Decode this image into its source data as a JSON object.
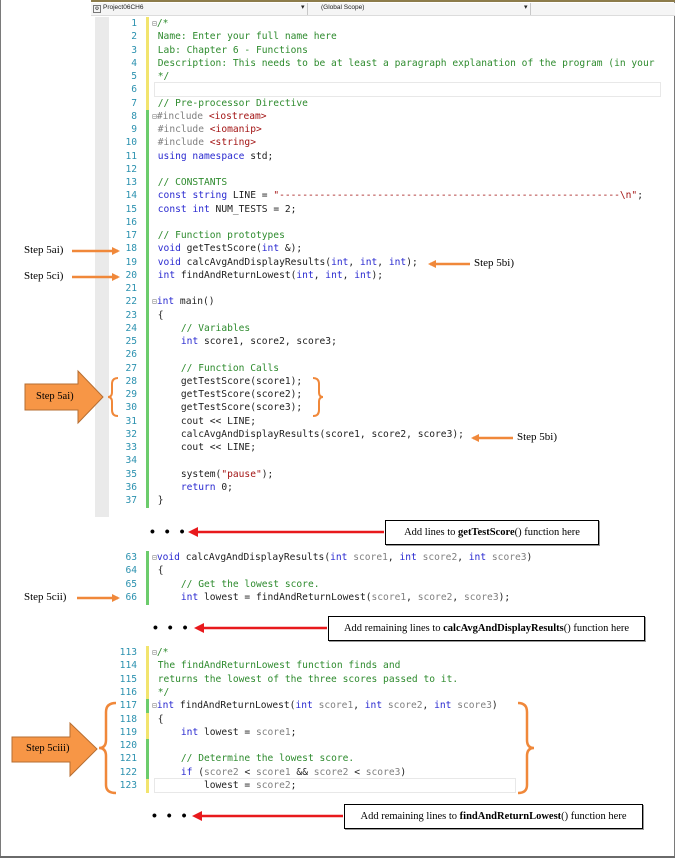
{
  "navbar": {
    "project": "Project06CH6",
    "scope": "(Global Scope)",
    "project_icon": "project-icon",
    "dropdown_icon": "▾"
  },
  "blocks": [
    {
      "lines": [
        {
          "n": "1",
          "html": "<span class='fold'>⊟</span><span class='cm'>/*</span>",
          "bar": "y"
        },
        {
          "n": "2",
          "html": " <span class='cm'>Name: Enter your full name here</span>",
          "bar": "y"
        },
        {
          "n": "3",
          "html": " <span class='cm'>Lab: Chapter 6 - Functions</span>",
          "bar": "y"
        },
        {
          "n": "4",
          "html": " <span class='cm'>Description: This needs to be at least a paragraph explanation of the program (in your</span>",
          "bar": "y"
        },
        {
          "n": "5",
          "html": " <span class='cm'>*/</span>",
          "bar": "y"
        },
        {
          "n": "6",
          "html": " ",
          "bar": "y",
          "caret": true
        },
        {
          "n": "7",
          "html": " <span class='cm'>// Pre-processor Directive</span>",
          "bar": "y"
        },
        {
          "n": "8",
          "html": "<span class='fold'>⊟</span><span class='pp'>#include</span> <span class='st'>&lt;iostream&gt;</span>",
          "bar": "g"
        },
        {
          "n": "9",
          "html": " <span class='pp'>#include</span> <span class='st'>&lt;iomanip&gt;</span>",
          "bar": "g"
        },
        {
          "n": "10",
          "html": " <span class='pp'>#include</span> <span class='st'>&lt;string&gt;</span>",
          "bar": "g"
        },
        {
          "n": "11",
          "html": " <span class='kw'>using namespace</span> std;",
          "bar": "g"
        },
        {
          "n": "12",
          "html": "",
          "bar": "g"
        },
        {
          "n": "13",
          "html": " <span class='cm'>// CONSTANTS</span>",
          "bar": "g"
        },
        {
          "n": "14",
          "html": " <span class='kw'>const</span> <span class='kw'>string</span> LINE = <span class='st'>\"-----------------------------------------------------------\\n\"</span>;",
          "bar": "g"
        },
        {
          "n": "15",
          "html": " <span class='kw'>const</span> <span class='kw'>int</span> NUM_TESTS = 2;",
          "bar": "g"
        },
        {
          "n": "16",
          "html": "",
          "bar": "g"
        },
        {
          "n": "17",
          "html": " <span class='cm'>// Function prototypes</span>",
          "bar": "g"
        },
        {
          "n": "18",
          "html": " <span class='kw'>void</span> getTestScore(<span class='kw'>int</span> &amp;);",
          "bar": "g"
        },
        {
          "n": "19",
          "html": " <span class='kw'>void</span> calcAvgAndDisplayResults(<span class='kw'>int</span>, <span class='kw'>int</span>, <span class='kw'>int</span>);",
          "bar": "g"
        },
        {
          "n": "20",
          "html": " <span class='kw'>int</span> findAndReturnLowest(<span class='kw'>int</span>, <span class='kw'>int</span>, <span class='kw'>int</span>);",
          "bar": "g"
        },
        {
          "n": "21",
          "html": "",
          "bar": "g"
        },
        {
          "n": "22",
          "html": "<span class='fold'>⊟</span><span class='kw'>int</span> main()",
          "bar": "g"
        },
        {
          "n": "23",
          "html": " {",
          "bar": "g"
        },
        {
          "n": "24",
          "html": "     <span class='cm'>// Variables</span>",
          "bar": "g"
        },
        {
          "n": "25",
          "html": "     <span class='kw'>int</span> score1, score2, score3;",
          "bar": "g"
        },
        {
          "n": "26",
          "html": "",
          "bar": "g"
        },
        {
          "n": "27",
          "html": "     <span class='cm'>// Function Calls</span>",
          "bar": "g"
        },
        {
          "n": "28",
          "html": "     getTestScore(score1);",
          "bar": "g"
        },
        {
          "n": "29",
          "html": "     getTestScore(score2);",
          "bar": "g"
        },
        {
          "n": "30",
          "html": "     getTestScore(score3);",
          "bar": "g"
        },
        {
          "n": "31",
          "html": "     cout &lt;&lt; LINE;",
          "bar": "g"
        },
        {
          "n": "32",
          "html": "     calcAvgAndDisplayResults(score1, score2, score3);",
          "bar": "g"
        },
        {
          "n": "33",
          "html": "     cout &lt;&lt; LINE;",
          "bar": "g"
        },
        {
          "n": "34",
          "html": "",
          "bar": "g"
        },
        {
          "n": "35",
          "html": "     system(<span class='st'>\"pause\"</span>);",
          "bar": "g"
        },
        {
          "n": "36",
          "html": "     <span class='kw'>return</span> 0;",
          "bar": "g"
        },
        {
          "n": "37",
          "html": " }",
          "bar": "g"
        }
      ]
    },
    {
      "lines": [
        {
          "n": "63",
          "html": "<span class='fold'>⊟</span><span class='kw'>void</span> calcAvgAndDisplayResults(<span class='kw'>int</span> <span class='pm'>score1</span>, <span class='kw'>int</span> <span class='pm'>score2</span>, <span class='kw'>int</span> <span class='pm'>score3</span>)",
          "bar": "g"
        },
        {
          "n": "64",
          "html": " {",
          "bar": "g"
        },
        {
          "n": "65",
          "html": "     <span class='cm'>// Get the lowest score.</span>",
          "bar": "g"
        },
        {
          "n": "66",
          "html": "     <span class='kw'>int</span> lowest = findAndReturnLowest(<span class='pm'>score1</span>, <span class='pm'>score2</span>, <span class='pm'>score3</span>);",
          "bar": "g"
        }
      ]
    },
    {
      "lines": [
        {
          "n": "113",
          "html": "<span class='fold'>⊟</span><span class='cm'>/*</span>",
          "bar": "y"
        },
        {
          "n": "114",
          "html": " <span class='cm'>The findAndReturnLowest function finds and</span>",
          "bar": "y"
        },
        {
          "n": "115",
          "html": " <span class='cm'>returns the lowest of the three scores passed to it.</span>",
          "bar": "y"
        },
        {
          "n": "116",
          "html": " <span class='cm'>*/</span>",
          "bar": "y"
        },
        {
          "n": "117",
          "html": "<span class='fold'>⊟</span><span class='kw'>int</span> findAndReturnLowest(<span class='kw'>int</span> <span class='pm'>score1</span>, <span class='kw'>int</span> <span class='pm'>score2</span>, <span class='kw'>int</span> <span class='pm'>score3</span>)",
          "bar": "g"
        },
        {
          "n": "118",
          "html": " {",
          "bar": "y"
        },
        {
          "n": "119",
          "html": "     <span class='kw'>int</span> lowest = <span class='pm'>score1</span>;",
          "bar": "y"
        },
        {
          "n": "120",
          "html": "",
          "bar": "g"
        },
        {
          "n": "121",
          "html": "     <span class='cm'>// Determine the lowest score.</span>",
          "bar": "g"
        },
        {
          "n": "122",
          "html": "     <span class='kw'>if</span> (<span class='pm'>score2</span> &lt; <span class='pm'>score1</span> &amp;&amp; <span class='pm'>score2</span> &lt; <span class='pm'>score3</span>)",
          "bar": "g"
        },
        {
          "n": "123",
          "html": "         lowest = <span class='pm'>score2</span>;",
          "bar": "y",
          "caret": true
        }
      ]
    }
  ],
  "annotations": {
    "step_5ai_line18": "Step 5ai)",
    "step_5ci_line20": "Step 5ci)",
    "step_5bi_line19": "Step 5bi)",
    "step_5ai_calls": "Step 5ai)",
    "step_5bi_line32": "Step 5bi)",
    "step_5cii_line66": "Step 5cii)",
    "step_5ciii_block": "Step 5ciii)",
    "ellipsis": "• • •",
    "note1_prefix": "Add lines to ",
    "note1_bold": "getTestScore",
    "note1_suffix": "() function here",
    "note2_prefix": "Add remaining lines to ",
    "note2_bold": "calcAvgAndDisplayResults",
    "note2_suffix": "() function here",
    "note3_prefix": "Add remaining lines to ",
    "note3_bold": "findAndReturnLowest",
    "note3_suffix": "() function here"
  },
  "colors": {
    "orange": "#f0883a",
    "red_arrow": "#e8191c",
    "big_arrow_fill": "#f79646",
    "big_arrow_stroke": "#b66d31"
  }
}
